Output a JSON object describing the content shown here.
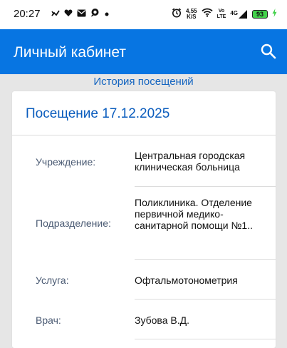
{
  "status_bar": {
    "time": "20:27",
    "net_speed_value": "4,55",
    "net_speed_unit": "K/S",
    "volte_top": "Vo",
    "volte_bottom": "LTE",
    "network": "4G",
    "battery": "93"
  },
  "app_bar": {
    "title": "Личный кабинет"
  },
  "section": {
    "title": "История посещений"
  },
  "visit_card": {
    "title": "Посещение 17.12.2025",
    "rows": [
      {
        "label": "Учреждение:",
        "value": "Центральная городская клиническая больница"
      },
      {
        "label": "Подразделение:",
        "value": "Поликлиника. Отделение первичной медико-санитарной помощи №1.."
      },
      {
        "label": "Услуга:",
        "value": "Офтальмотонометрия"
      },
      {
        "label": "Врач:",
        "value": "Зубова В.Д."
      }
    ]
  },
  "colors": {
    "primary": "#0775e2",
    "link": "#1565c0",
    "label": "#4a5a73",
    "battery": "#43d14b"
  }
}
